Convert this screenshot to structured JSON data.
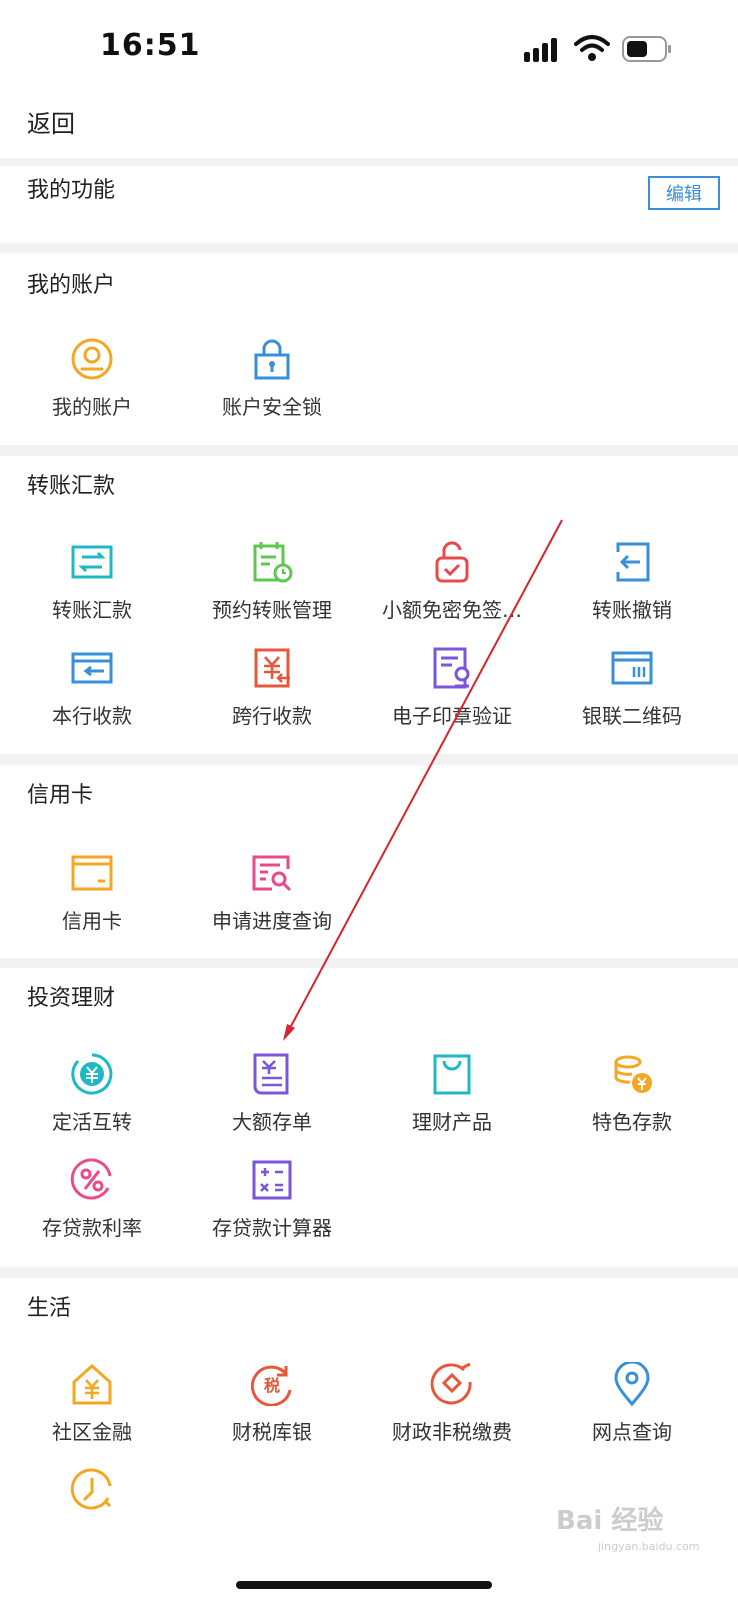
{
  "status": {
    "time": "16:51"
  },
  "nav": {
    "back": "返回"
  },
  "my_functions": {
    "title": "我的功能",
    "edit": "编辑"
  },
  "my_account": {
    "title": "我的账户",
    "items": [
      {
        "label": "我的账户",
        "icon": "user-circle-icon",
        "color": "#f5a623"
      },
      {
        "label": "账户安全锁",
        "icon": "padlock-icon",
        "color": "#3a8fd9"
      }
    ]
  },
  "transfer": {
    "title": "转账汇款",
    "items": [
      {
        "label": "转账汇款",
        "icon": "transfer-icon",
        "color": "#1fb8c4"
      },
      {
        "label": "预约转账管理",
        "icon": "scheduled-transfer-icon",
        "color": "#5cc84e"
      },
      {
        "label": "小额免密免签…",
        "icon": "unlock-check-icon",
        "color": "#e84a4a"
      },
      {
        "label": "转账撤销",
        "icon": "transfer-revoke-icon",
        "color": "#3a8fd9"
      },
      {
        "label": "本行收款",
        "icon": "card-receive-icon",
        "color": "#3a8fd9"
      },
      {
        "label": "跨行收款",
        "icon": "yuan-receive-icon",
        "color": "#e8573a"
      },
      {
        "label": "电子印章验证",
        "icon": "e-seal-icon",
        "color": "#7b56d9"
      },
      {
        "label": "银联二维码",
        "icon": "qr-code-icon",
        "color": "#3a8fd9"
      }
    ]
  },
  "credit_card": {
    "title": "信用卡",
    "items": [
      {
        "label": "信用卡",
        "icon": "credit-card-icon",
        "color": "#f5a623"
      },
      {
        "label": "申请进度查询",
        "icon": "progress-search-icon",
        "color": "#e84a8c"
      }
    ]
  },
  "investment": {
    "title": "投资理财",
    "items": [
      {
        "label": "定活互转",
        "icon": "yuan-cycle-icon",
        "color": "#1fb8c4"
      },
      {
        "label": "大额存单",
        "icon": "deposit-certificate-icon",
        "color": "#7b56d9"
      },
      {
        "label": "理财产品",
        "icon": "shopping-bag-icon",
        "color": "#1fb8c4"
      },
      {
        "label": "特色存款",
        "icon": "coin-stack-icon",
        "color": "#f5a623"
      },
      {
        "label": "存贷款利率",
        "icon": "percent-icon",
        "color": "#e84a8c"
      },
      {
        "label": "存贷款计算器",
        "icon": "calculator-icon",
        "color": "#7b56d9"
      }
    ]
  },
  "life": {
    "title": "生活",
    "items": [
      {
        "label": "社区金融",
        "icon": "house-yuan-icon",
        "color": "#f5a623"
      },
      {
        "label": "财税库银",
        "icon": "tax-icon",
        "color": "#e8573a"
      },
      {
        "label": "财政非税缴费",
        "icon": "payment-circle-icon",
        "color": "#e8573a"
      },
      {
        "label": "网点查询",
        "icon": "location-pin-icon",
        "color": "#3a8fd9"
      },
      {
        "label": "",
        "icon": "clock-icon",
        "color": "#f5a623"
      }
    ]
  },
  "watermark": {
    "text": "Bai 经验",
    "sub": "jingyan.baidu.com"
  }
}
